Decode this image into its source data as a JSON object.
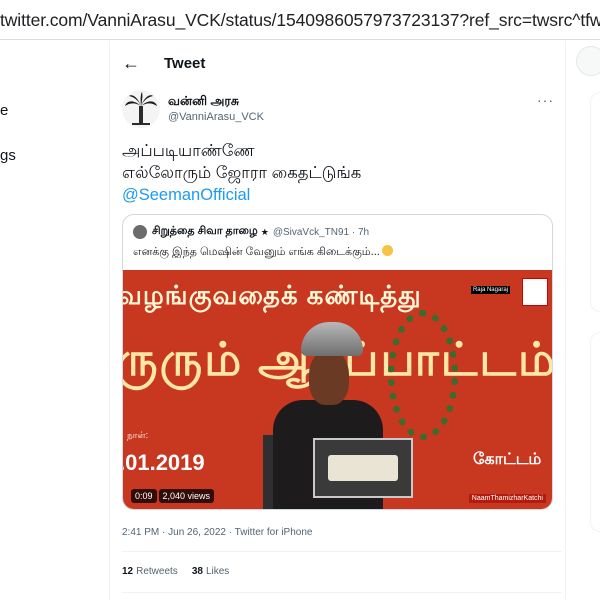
{
  "browser": {
    "url": "twitter.com/VanniArasu_VCK/status/1540986057973723137?ref_src=twsrc^tfw|twcam"
  },
  "left_fragments": [
    "e",
    "gs"
  ],
  "header": {
    "title": "Tweet"
  },
  "tweet": {
    "author_name": "வன்னி அரசு",
    "author_handle": "@VanniArasu_VCK",
    "text_line1": "அப்படியாண்ணே",
    "text_line2": "எல்லோரும் ஜோரா கைதட்டுங்க",
    "mention": "@SeemanOfficial",
    "timestamp": "2:41 PM · Jun 26, 2022 · Twitter for iPhone",
    "retweets_count": "12",
    "retweets_label": "Retweets",
    "likes_count": "38",
    "likes_label": "Likes"
  },
  "quoted": {
    "name": "சிறுத்தை சிவா தாழை",
    "star": "★",
    "handle_time": "@SivaVck_TN91 · 7h",
    "text": "எனக்கு இந்த மெஷின் வேனும் எங்க கிடைக்கும்...",
    "video": {
      "banner_top": "வழங்குவதைக் கண்டித்து",
      "banner_mid": "ருரும் ஆர்ப்பாட்டம்",
      "date_label": "நாள்:",
      "date": ".01.2019",
      "kottam": "கோட்டம்",
      "watermark": "Raja Nagaraj",
      "duration": "0:09",
      "views": "2,040 views",
      "ticker": "NaamThamizharKatchi"
    }
  },
  "colors": {
    "accent": "#1d9bf0",
    "video_bg": "#c8371f"
  }
}
